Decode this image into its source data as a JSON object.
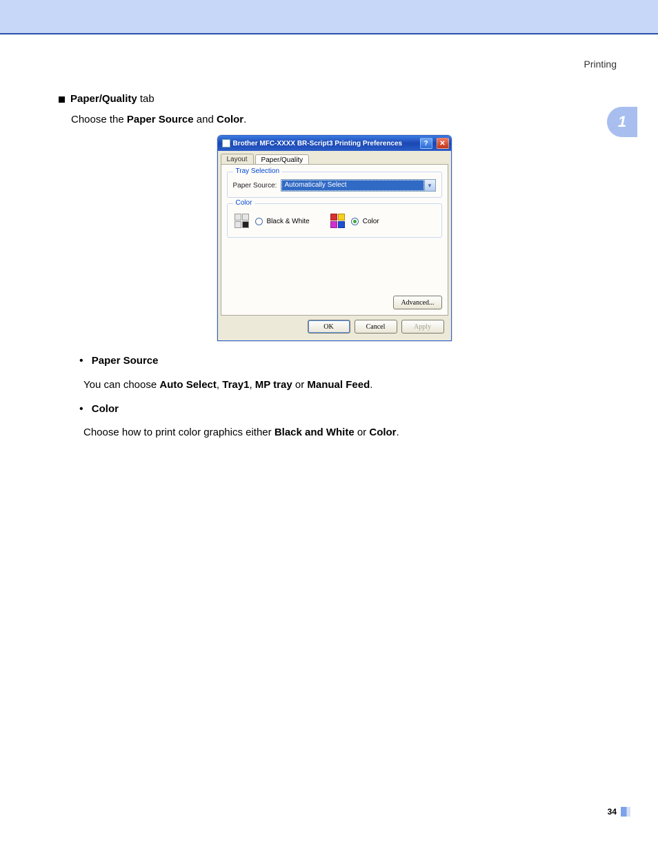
{
  "header": {
    "section": "Printing"
  },
  "sideTab": {
    "label": "1"
  },
  "pageNumber": "34",
  "section_heading": {
    "bold": "Paper/Quality",
    "rest": " tab"
  },
  "intro": {
    "pre": "Choose the ",
    "b1": "Paper Source",
    "mid": " and ",
    "b2": "Color",
    "post": "."
  },
  "dialog": {
    "title": "Brother MFC-XXXX BR-Script3 Printing Preferences",
    "tabs": {
      "layout": "Layout",
      "paperQuality": "Paper/Quality"
    },
    "traySelection": {
      "legend": "Tray Selection",
      "label": "Paper Source:",
      "selected": "Automatically Select"
    },
    "colorGroup": {
      "legend": "Color",
      "bw": "Black & White",
      "color": "Color"
    },
    "buttons": {
      "advanced": "Advanced...",
      "ok": "OK",
      "cancel": "Cancel",
      "apply": "Apply"
    }
  },
  "desc": {
    "paperSource": {
      "heading": "Paper Source",
      "pre": "You can choose ",
      "b1": "Auto Select",
      "c1": ", ",
      "b2": "Tray1",
      "c2": ", ",
      "b3": "MP tray",
      "c3": " or ",
      "b4": "Manual Feed",
      "post": "."
    },
    "color": {
      "heading": "Color",
      "pre": "Choose how to print color graphics either ",
      "b1": "Black and White",
      "c1": " or ",
      "b2": "Color",
      "post": "."
    }
  }
}
